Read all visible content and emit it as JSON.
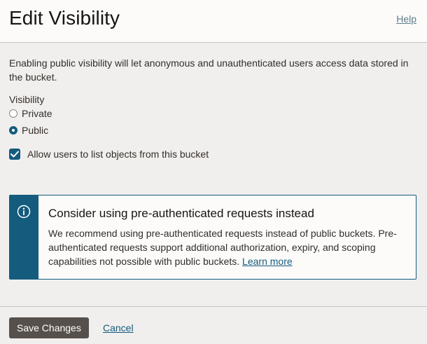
{
  "header": {
    "title": "Edit Visibility",
    "help_label": "Help"
  },
  "intro": {
    "text": "Enabling public visibility will let anonymous and unauthenticated users access data stored in the bucket."
  },
  "visibility": {
    "label": "Visibility",
    "options": [
      {
        "label": "Private",
        "selected": false
      },
      {
        "label": "Public",
        "selected": true
      }
    ]
  },
  "list_objects": {
    "label": "Allow users to list objects from this bucket",
    "checked": true
  },
  "info": {
    "icon": "info-icon",
    "title": "Consider using pre-authenticated requests instead",
    "text": "We recommend using pre-authenticated requests instead of public buckets. Pre-authenticated requests support additional authorization, expiry, and scoping capabilities not possible with public buckets.",
    "link_label": "Learn more"
  },
  "footer": {
    "save_label": "Save Changes",
    "cancel_label": "Cancel"
  },
  "colors": {
    "accent": "#145b7d",
    "button": "#55504b",
    "background": "#f1efed"
  }
}
